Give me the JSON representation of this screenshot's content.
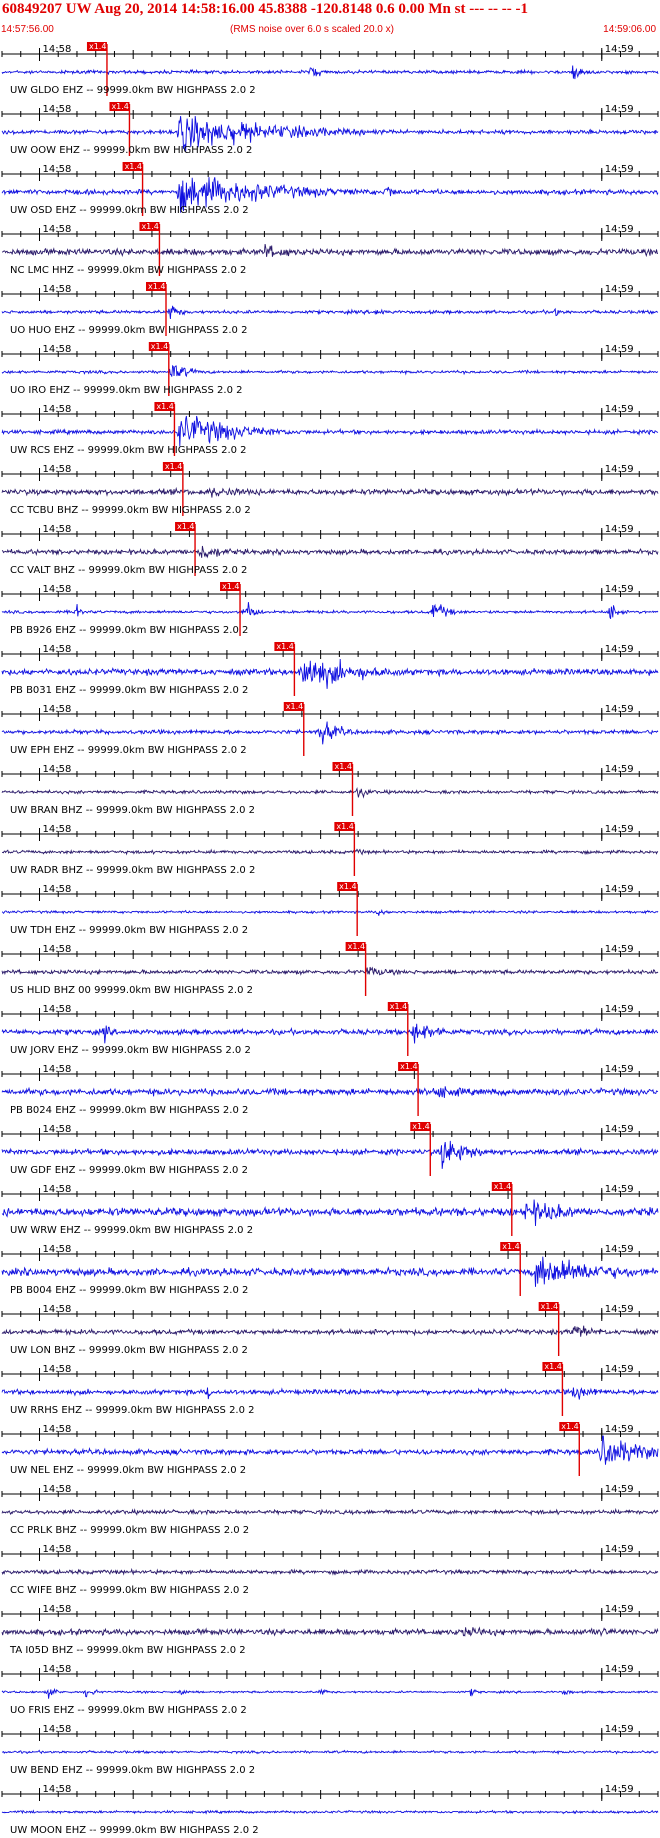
{
  "header": {
    "title": "60849207 UW Aug 20, 2014 14:58:16.00   45.8388 -120.8148  0.6 0.00 Mn st --- -- --   -1",
    "start_time": "14:57:56.00",
    "end_time": "14:59:06.00",
    "note": "(RMS noise over 6.0 s scaled 20.0 x)"
  },
  "colors": {
    "trace_blue": "#1010e0",
    "trace_purple": "#2a1a6a",
    "pick_red": "#e00000",
    "text": "#000000",
    "header_red": "#e00000"
  },
  "chart_data": {
    "type": "line",
    "x_unit": "seconds after 14:57:56.00",
    "xlim": [
      0,
      70
    ],
    "minute_ticks": [
      {
        "label": "14:58",
        "t": 4
      },
      {
        "label": "14:59",
        "t": 64
      }
    ],
    "pick_label": "x1.4",
    "traces": [
      {
        "label": "UW GLDO EHZ -- 99999.0km BW  HIGHPASS  2.0  2",
        "color": "blue",
        "pick_t": 11.2,
        "amp": 0.08,
        "bursts": [
          [
            33,
            0.4,
            1.2
          ],
          [
            61,
            0.5,
            1.0
          ]
        ]
      },
      {
        "label": "UW OOW EHZ -- 99999.0km BW  HIGHPASS  2.0  2",
        "color": "blue",
        "pick_t": 13.6,
        "amp": 0.1,
        "bursts": [
          [
            19,
            1.0,
            10.0
          ],
          [
            21,
            0.8,
            2.0
          ]
        ]
      },
      {
        "label": "UW OSD EHZ -- 99999.0km BW  HIGHPASS  2.0  2",
        "color": "blue",
        "pick_t": 15.0,
        "amp": 0.12,
        "bursts": [
          [
            19,
            1.0,
            10.0
          ],
          [
            41,
            0.5,
            1.0
          ]
        ]
      },
      {
        "label": "NC LMC HHZ -- 99999.0km BW  HIGHPASS  2.0  2",
        "color": "purple",
        "pick_t": 16.8,
        "amp": 0.15,
        "bursts": [
          [
            28,
            0.4,
            4.0
          ]
        ]
      },
      {
        "label": "UO HUO EHZ -- 99999.0km BW  HIGHPASS  2.0  2",
        "color": "blue",
        "pick_t": 17.5,
        "amp": 0.08,
        "bursts": [
          [
            18,
            0.5,
            1.0
          ],
          [
            40,
            0.3,
            0.8
          ],
          [
            59,
            0.3,
            0.8
          ]
        ]
      },
      {
        "label": "UO IRO EHZ -- 99999.0km BW  HIGHPASS  2.0  2",
        "color": "blue",
        "pick_t": 17.8,
        "amp": 0.07,
        "bursts": [
          [
            18,
            0.5,
            2.0
          ]
        ]
      },
      {
        "label": "UW RCS EHZ -- 99999.0km BW  HIGHPASS  2.0  2",
        "color": "blue",
        "pick_t": 18.4,
        "amp": 0.1,
        "bursts": [
          [
            19,
            1.0,
            6.0
          ]
        ]
      },
      {
        "label": "CC TCBU BHZ -- 99999.0km BW  HIGHPASS  2.0  2",
        "color": "purple",
        "pick_t": 19.3,
        "amp": 0.14,
        "bursts": [
          [
            22,
            0.3,
            6.0
          ],
          [
            63,
            0.3,
            1.0
          ]
        ]
      },
      {
        "label": "CC VALT BHZ -- 99999.0km BW  HIGHPASS  2.0  2",
        "color": "purple",
        "pick_t": 20.6,
        "amp": 0.12,
        "bursts": [
          [
            21,
            0.5,
            3.0
          ]
        ]
      },
      {
        "label": "PB B926 EHZ -- 99999.0km BW  HIGHPASS  2.0  2",
        "color": "blue",
        "pick_t": 25.4,
        "amp": 0.07,
        "bursts": [
          [
            8,
            0.6,
            0.5
          ],
          [
            26,
            0.6,
            1.0
          ],
          [
            46,
            0.6,
            1.5
          ],
          [
            65,
            0.6,
            0.8
          ]
        ]
      },
      {
        "label": "PB B031 EHZ -- 99999.0km BW  HIGHPASS  2.0  2",
        "color": "blue",
        "pick_t": 31.2,
        "amp": 0.15,
        "bursts": [
          [
            32,
            1.0,
            6.0
          ]
        ]
      },
      {
        "label": "UW EPH EHZ -- 99999.0km BW  HIGHPASS  2.0  2",
        "color": "blue",
        "pick_t": 32.2,
        "amp": 0.1,
        "bursts": [
          [
            34,
            0.7,
            2.0
          ]
        ]
      },
      {
        "label": "UW BRAN BHZ -- 99999.0km BW  HIGHPASS  2.0  2",
        "color": "purple",
        "pick_t": 37.4,
        "amp": 0.08,
        "bursts": [
          [
            38,
            0.3,
            1.5
          ]
        ]
      },
      {
        "label": "UW RADR BHZ -- 99999.0km BW  HIGHPASS  2.0  2",
        "color": "purple",
        "pick_t": 37.6,
        "amp": 0.08,
        "bursts": [
          [
            38,
            0.2,
            1.0
          ]
        ]
      },
      {
        "label": "UW TDH EHZ -- 99999.0km BW  HIGHPASS  2.0  2",
        "color": "blue",
        "pick_t": 37.9,
        "amp": 0.06,
        "bursts": [
          [
            40,
            0.2,
            1.5
          ]
        ]
      },
      {
        "label": "US HLID BHZ 00 99999.0km BW  HIGHPASS  2.0  2",
        "color": "purple",
        "pick_t": 38.8,
        "amp": 0.1,
        "bursts": [
          [
            39,
            0.3,
            3.0
          ]
        ]
      },
      {
        "label": "UW JORV EHZ -- 99999.0km BW  HIGHPASS  2.0  2",
        "color": "blue",
        "pick_t": 43.3,
        "amp": 0.13,
        "bursts": [
          [
            11,
            0.6,
            0.5
          ],
          [
            44,
            0.6,
            3.0
          ]
        ]
      },
      {
        "label": "PB B024 EHZ -- 99999.0km BW  HIGHPASS  2.0  2",
        "color": "blue",
        "pick_t": 44.4,
        "amp": 0.16,
        "bursts": [
          [
            46,
            0.4,
            4.0
          ]
        ]
      },
      {
        "label": "UW GDF EHZ -- 99999.0km BW  HIGHPASS  2.0  2",
        "color": "blue",
        "pick_t": 45.7,
        "amp": 0.14,
        "bursts": [
          [
            47,
            0.9,
            3.0
          ]
        ]
      },
      {
        "label": "UW WRW EHZ -- 99999.0km BW  HIGHPASS  2.0  2",
        "color": "blue",
        "pick_t": 54.4,
        "amp": 0.2,
        "bursts": [
          [
            56,
            0.7,
            5.0
          ]
        ]
      },
      {
        "label": "PB B004 EHZ -- 99999.0km BW  HIGHPASS  2.0  2",
        "color": "blue",
        "pick_t": 55.3,
        "amp": 0.18,
        "bursts": [
          [
            57,
            0.9,
            8.0
          ]
        ]
      },
      {
        "label": "UW LON BHZ -- 99999.0km BW  HIGHPASS  2.0  2",
        "color": "purple",
        "pick_t": 59.4,
        "amp": 0.12,
        "bursts": [
          [
            61,
            0.4,
            3.0
          ]
        ]
      },
      {
        "label": "UW RRHS EHZ -- 99999.0km BW  HIGHPASS  2.0  2",
        "color": "blue",
        "pick_t": 59.8,
        "amp": 0.12,
        "bursts": [
          [
            22,
            0.5,
            0.5
          ],
          [
            61,
            0.4,
            3.0
          ]
        ]
      },
      {
        "label": "UW NEL EHZ -- 99999.0km BW  HIGHPASS  2.0  2",
        "color": "blue",
        "pick_t": 61.6,
        "amp": 0.13,
        "bursts": [
          [
            64,
            0.9,
            5.0
          ]
        ]
      },
      {
        "label": "CC PRLK BHZ -- 99999.0km BW  HIGHPASS  2.0  2",
        "color": "purple",
        "pick_t": null,
        "amp": 0.1,
        "bursts": []
      },
      {
        "label": "CC WIFE BHZ -- 99999.0km BW  HIGHPASS  2.0  2",
        "color": "purple",
        "pick_t": null,
        "amp": 0.1,
        "bursts": []
      },
      {
        "label": "TA I05D BHZ -- 99999.0km BW  HIGHPASS  2.0  2",
        "color": "purple",
        "pick_t": null,
        "amp": 0.14,
        "bursts": [
          [
            49,
            0.3,
            6.0
          ],
          [
            63,
            0.3,
            4.0
          ]
        ]
      },
      {
        "label": "UO FRIS EHZ -- 99999.0km BW  HIGHPASS  2.0  2",
        "color": "blue",
        "pick_t": null,
        "amp": 0.05,
        "bursts": [
          [
            5,
            0.3,
            1.0
          ],
          [
            9,
            0.3,
            1.0
          ],
          [
            19,
            0.2,
            1.0
          ],
          [
            34,
            0.2,
            1.0
          ],
          [
            50,
            0.2,
            1.0
          ],
          [
            60,
            0.2,
            1.0
          ]
        ]
      },
      {
        "label": "UW BEND EHZ -- 99999.0km BW  HIGHPASS  2.0  2",
        "color": "blue",
        "pick_t": null,
        "amp": 0.06,
        "bursts": []
      },
      {
        "label": "UW MOON EHZ -- 99999.0km BW  HIGHPASS  2.0  2",
        "color": "blue",
        "pick_t": null,
        "amp": 0.06,
        "bursts": []
      }
    ]
  }
}
